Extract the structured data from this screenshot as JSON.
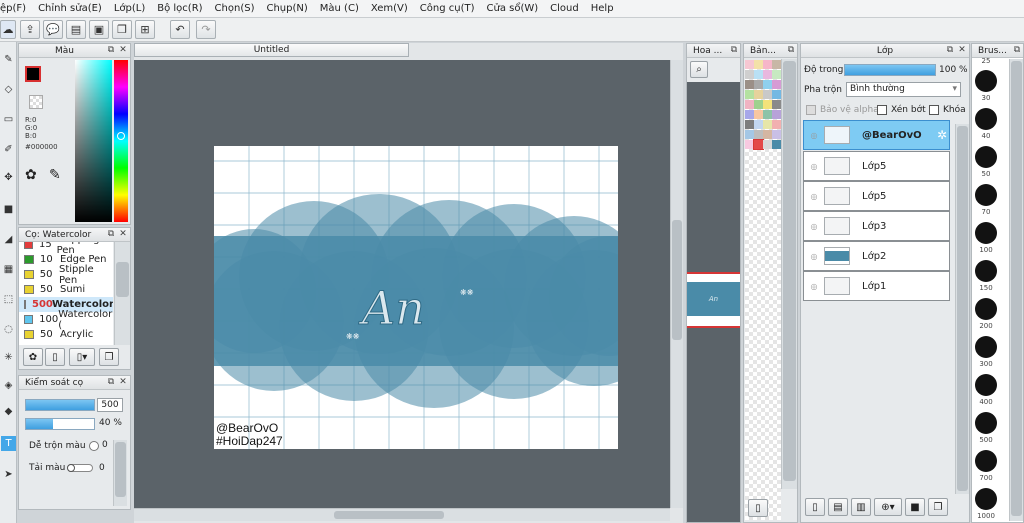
{
  "menu": [
    "ệp(F)",
    "Chỉnh sửa(E)",
    "Lớp(L)",
    "Bộ lọc(R)",
    "Chọn(S)",
    "Chụp(N)",
    "Màu (C)",
    "Xem(V)",
    "Công cụ(T)",
    "Cửa sổ(W)",
    "Cloud",
    "Help"
  ],
  "color_panel": {
    "title": "Màu",
    "r": "R:0",
    "g": "G:0",
    "b": "B:0",
    "hex": "#000000"
  },
  "brush_list": {
    "title": "Cọ: Watercolor",
    "items": [
      {
        "size": "15",
        "name": "Mapping Pen",
        "color": "#e23c3c"
      },
      {
        "size": "10",
        "name": "Edge Pen",
        "color": "#2c9a2c"
      },
      {
        "size": "50",
        "name": "Stipple Pen",
        "color": "#e8d232"
      },
      {
        "size": "50",
        "name": "Sumi",
        "color": "#e8d232"
      },
      {
        "size": "500",
        "name": "Watercolor",
        "color": "#5fc6ee"
      },
      {
        "size": "100",
        "name": "Watercolor (",
        "color": "#5fc6ee"
      },
      {
        "size": "50",
        "name": "Acrylic",
        "color": "#e8d232"
      }
    ]
  },
  "brush_control": {
    "title": "Kiểm soát cọ",
    "size_value": "500",
    "opacity_value": "40 %",
    "blend_label": "Dễ trộn màu",
    "blend_value": "0",
    "rebuild_label": "Tải màu",
    "rebuild_value": "0"
  },
  "document": {
    "tab": "Untitled",
    "watermark_line1": "@BearOvO",
    "watermark_line2": "#HoiDap247",
    "art_text": "An"
  },
  "navigator": {
    "title": "Hoa ..."
  },
  "palette": {
    "title": "Bản..."
  },
  "layers": {
    "title": "Lớp",
    "opacity_label": "Độ trong",
    "opacity_value": "100 %",
    "blend_label": "Pha trộn",
    "blend_value": "Bình thường",
    "protect_alpha": "Bảo vệ alpha",
    "clipping": "Xén bớt",
    "lock": "Khóa",
    "items": [
      "@BearOvO",
      "Lớp5",
      "Lớp5",
      "Lớp3",
      "Lớp2",
      "Lớp1"
    ]
  },
  "brush_sizes": {
    "title": "Brus...",
    "values": [
      "25",
      "30",
      "40",
      "50",
      "70",
      "100",
      "150",
      "200",
      "300",
      "400",
      "500",
      "700",
      "1000"
    ]
  }
}
